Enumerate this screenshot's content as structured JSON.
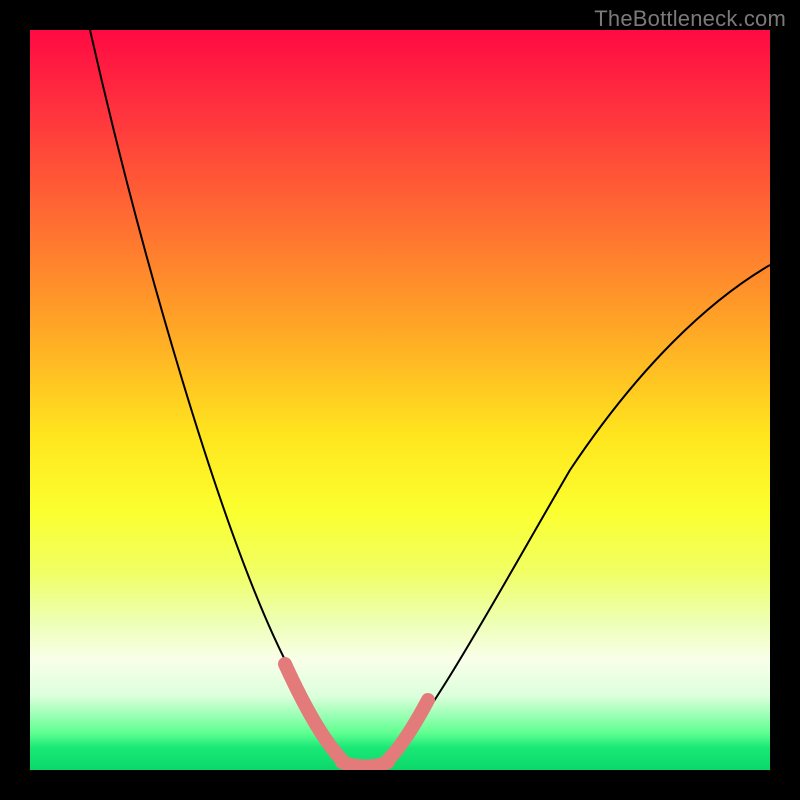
{
  "watermark": "TheBottleneck.com",
  "colors": {
    "frame": "#000000",
    "curve": "#000000",
    "marker": "#e37b7b"
  },
  "chart_data": {
    "type": "line",
    "title": "",
    "xlabel": "",
    "ylabel": "",
    "xlim": [
      0,
      100
    ],
    "ylim": [
      0,
      100
    ],
    "grid": false,
    "legend": false,
    "note": "Values estimated from pixel positions; axes unlabeled. y = bottleneck severity (0 optimal, 100 worst).",
    "series": [
      {
        "name": "bottleneck-curve",
        "x": [
          5,
          10,
          15,
          20,
          25,
          30,
          33,
          36,
          38,
          40,
          42,
          44,
          46,
          50,
          55,
          60,
          65,
          70,
          80,
          90,
          100
        ],
        "y": [
          100,
          88,
          76,
          63,
          50,
          36,
          25,
          14,
          7,
          3,
          1,
          0.5,
          0.5,
          1,
          5,
          12,
          20,
          28,
          43,
          56,
          68
        ]
      }
    ],
    "highlight_x_range": [
      34,
      49
    ],
    "gradient_stops": [
      {
        "pos": 0,
        "color": "#ff0a42"
      },
      {
        "pos": 25,
        "color": "#ff6a32"
      },
      {
        "pos": 55,
        "color": "#ffe61e"
      },
      {
        "pos": 85,
        "color": "#f9ffe9"
      },
      {
        "pos": 100,
        "color": "#0bd86a"
      }
    ]
  }
}
